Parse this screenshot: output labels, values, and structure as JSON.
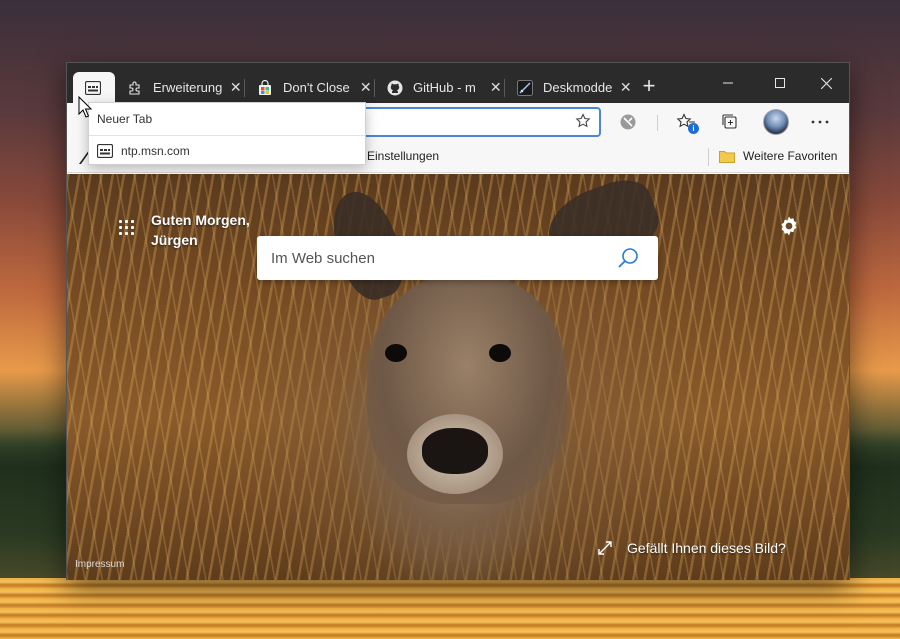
{
  "tabs": [
    {
      "title": "",
      "icon": "newtab-page-icon",
      "active": true
    },
    {
      "title": "Erweiterungen",
      "icon": "puzzle-icon",
      "active": false
    },
    {
      "title": "Don't Close",
      "icon": "store-icon",
      "active": false
    },
    {
      "title": "GitHub - m",
      "icon": "github-icon",
      "active": false
    },
    {
      "title": "Deskmodder",
      "icon": "deskmodder-icon",
      "active": false
    }
  ],
  "tab_tooltip": {
    "title": "Neuer Tab",
    "url": "ntp.msn.com"
  },
  "favorites": {
    "partial_item": "Einstellungen",
    "other": "Weitere Favoriten"
  },
  "toolbar": {
    "collections_badge": "i"
  },
  "ntp": {
    "greeting_line1": "Guten Morgen,",
    "greeting_line2": "Jürgen",
    "search_placeholder": "Im Web suchen",
    "impressum": "Impressum",
    "like_image": "Gefällt Ihnen dieses Bild?"
  },
  "colors": {
    "accent": "#4a86d8",
    "tabstrip": "#2b2b2b",
    "toolbar": "#f7f7f7"
  }
}
